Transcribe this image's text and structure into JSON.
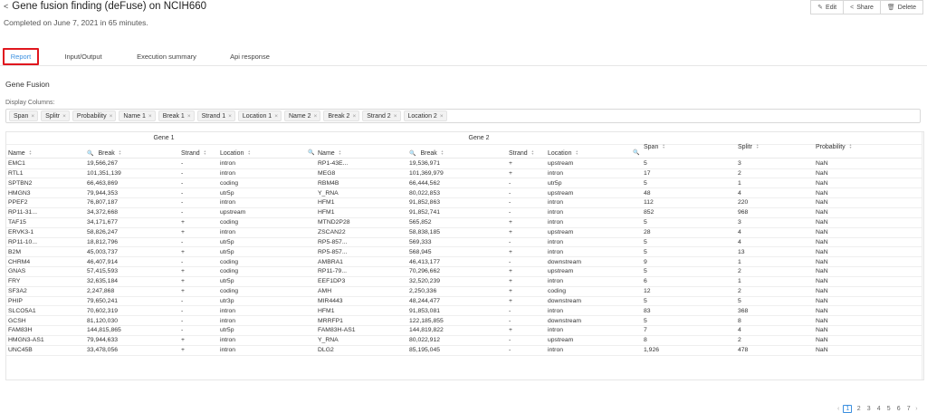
{
  "header": {
    "title": "Gene fusion finding (deFuse) on NCIH660",
    "subtitle": "Completed on June 7, 2021 in 65 minutes.",
    "actions": [
      {
        "label": "Edit",
        "icon": "edit-icon"
      },
      {
        "label": "Share",
        "icon": "share-icon"
      },
      {
        "label": "Delete",
        "icon": "trash-icon"
      }
    ]
  },
  "tabs": [
    {
      "label": "Report",
      "active": true
    },
    {
      "label": "Input/Output",
      "active": false
    },
    {
      "label": "Execution summary",
      "active": false
    },
    {
      "label": "Api response",
      "active": false
    }
  ],
  "section": {
    "title": "Gene Fusion",
    "display_columns_label": "Display Columns:",
    "chips": [
      "Span",
      "Splitr",
      "Probability",
      "Name 1",
      "Break 1",
      "Strand 1",
      "Location 1",
      "Name 2",
      "Break 2",
      "Strand 2",
      "Location 2"
    ]
  },
  "table": {
    "groups": [
      "Gene 1",
      "Gene 2"
    ],
    "columns": [
      "Name",
      "Break",
      "Strand",
      "Location",
      "Name",
      "Break",
      "Strand",
      "Location",
      "Span",
      "Splitr",
      "Probability"
    ],
    "rows": [
      [
        "EMC1",
        "19,566,267",
        "-",
        "intron",
        "RP1-43E...",
        "19,536,971",
        "+",
        "upstream",
        "5",
        "3",
        "NaN"
      ],
      [
        "RTL1",
        "101,351,139",
        "-",
        "intron",
        "MEG8",
        "101,369,979",
        "+",
        "intron",
        "17",
        "2",
        "NaN"
      ],
      [
        "SPTBN2",
        "66,463,869",
        "-",
        "coding",
        "RBM4B",
        "66,444,562",
        "-",
        "utr5p",
        "5",
        "1",
        "NaN"
      ],
      [
        "HMGN3",
        "79,944,353",
        "-",
        "utr5p",
        "Y_RNA",
        "80,022,853",
        "-",
        "upstream",
        "48",
        "4",
        "NaN"
      ],
      [
        "PPEF2",
        "76,807,187",
        "-",
        "intron",
        "HFM1",
        "91,852,863",
        "-",
        "intron",
        "112",
        "220",
        "NaN"
      ],
      [
        "RP11-31...",
        "34,372,668",
        "-",
        "upstream",
        "HFM1",
        "91,852,741",
        "-",
        "intron",
        "852",
        "968",
        "NaN"
      ],
      [
        "TAF15",
        "34,171,677",
        "+",
        "coding",
        "MTND2P28",
        "565,852",
        "+",
        "intron",
        "5",
        "3",
        "NaN"
      ],
      [
        "ERVK3-1",
        "58,826,247",
        "+",
        "intron",
        "ZSCAN22",
        "58,838,185",
        "+",
        "upstream",
        "28",
        "4",
        "NaN"
      ],
      [
        "RP11-10...",
        "18,812,796",
        "-",
        "utr5p",
        "RP5-857...",
        "569,333",
        "-",
        "intron",
        "5",
        "4",
        "NaN"
      ],
      [
        "B2M",
        "45,003,737",
        "+",
        "utr5p",
        "RP5-857...",
        "568,945",
        "+",
        "intron",
        "5",
        "13",
        "NaN"
      ],
      [
        "CHRM4",
        "46,407,914",
        "-",
        "coding",
        "AMBRA1",
        "46,413,177",
        "-",
        "downstream",
        "9",
        "1",
        "NaN"
      ],
      [
        "GNAS",
        "57,415,593",
        "+",
        "coding",
        "RP11-79...",
        "70,296,662",
        "+",
        "upstream",
        "5",
        "2",
        "NaN"
      ],
      [
        "FRY",
        "32,635,184",
        "+",
        "utr5p",
        "EEF1DP3",
        "32,520,239",
        "+",
        "intron",
        "6",
        "1",
        "NaN"
      ],
      [
        "SF3A2",
        "2,247,868",
        "+",
        "coding",
        "AMH",
        "2,250,336",
        "+",
        "coding",
        "12",
        "2",
        "NaN"
      ],
      [
        "PHIP",
        "79,650,241",
        "-",
        "utr3p",
        "MIR4443",
        "48,244,477",
        "+",
        "downstream",
        "5",
        "5",
        "NaN"
      ],
      [
        "SLCO5A1",
        "70,602,319",
        "-",
        "intron",
        "HFM1",
        "91,853,081",
        "-",
        "intron",
        "83",
        "368",
        "NaN"
      ],
      [
        "GCSH",
        "81,120,030",
        "-",
        "intron",
        "MRRFP1",
        "122,185,855",
        "-",
        "downstream",
        "5",
        "8",
        "NaN"
      ],
      [
        "FAM83H",
        "144,815,865",
        "-",
        "utr5p",
        "FAM83H-AS1",
        "144,819,822",
        "+",
        "intron",
        "7",
        "4",
        "NaN"
      ],
      [
        "HMGN3-AS1",
        "79,944,633",
        "+",
        "intron",
        "Y_RNA",
        "80,022,912",
        "-",
        "upstream",
        "8",
        "2",
        "NaN"
      ],
      [
        "UNC45B",
        "33,478,056",
        "+",
        "intron",
        "DLG2",
        "85,195,045",
        "-",
        "intron",
        "1,926",
        "478",
        "NaN"
      ]
    ]
  },
  "pagination": {
    "pages": [
      "1",
      "2",
      "3",
      "4",
      "5",
      "6",
      "7"
    ],
    "current": "1"
  }
}
